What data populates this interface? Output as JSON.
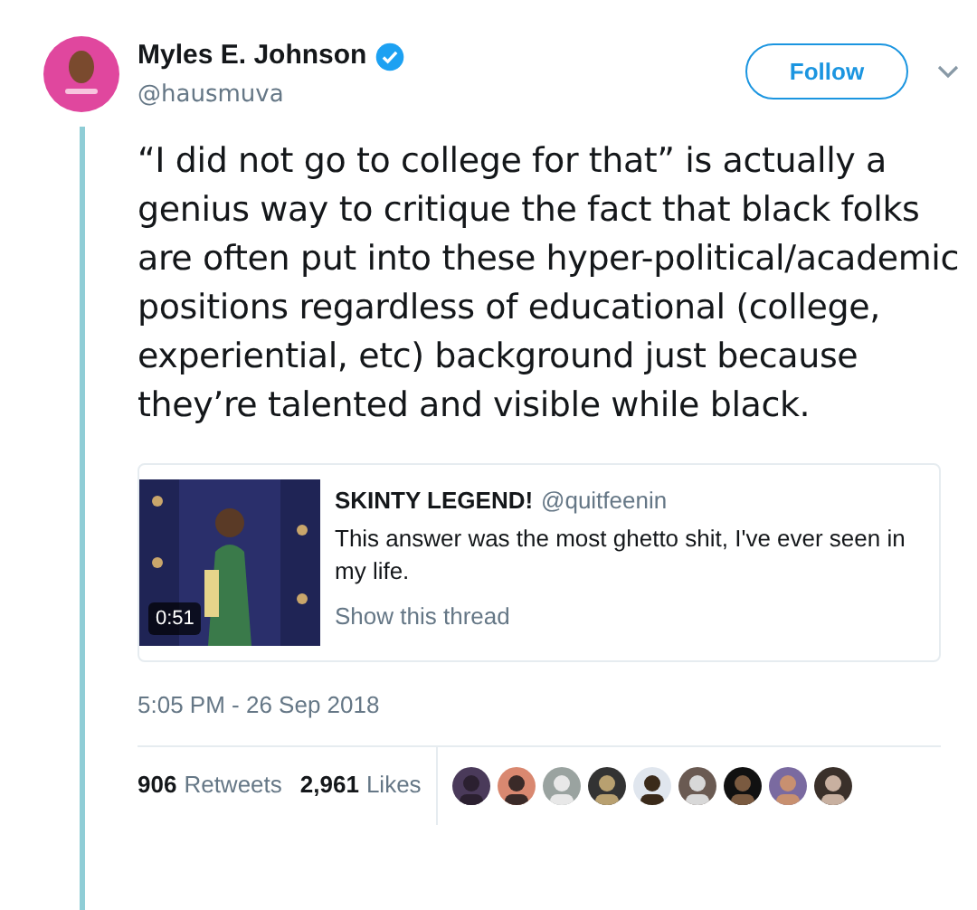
{
  "author": {
    "name": "Myles E. Johnson",
    "verified": true,
    "handle": "@hausmuva"
  },
  "follow_button": "Follow",
  "tweet_text": "“I did not go to college for that” is actually a genius way to critique the fact that black folks are often put into these hyper-political/academic positions regardless of educational (college, experiential, etc) background just because they’re talented and visible while black.",
  "quoted_tweet": {
    "media": {
      "kind": "picture",
      "duration": "0:51"
    },
    "name": "SKINTY LEGEND!",
    "handle": "@quitfeenin",
    "text": "This answer was the most ghetto shit, I've ever seen in my life.",
    "show_thread": "Show this thread"
  },
  "timestamp": "5:05 PM - 26 Sep 2018",
  "stats": [
    {
      "count": "906",
      "label": "Retweets"
    },
    {
      "count": "2,961",
      "label": "Likes"
    }
  ]
}
